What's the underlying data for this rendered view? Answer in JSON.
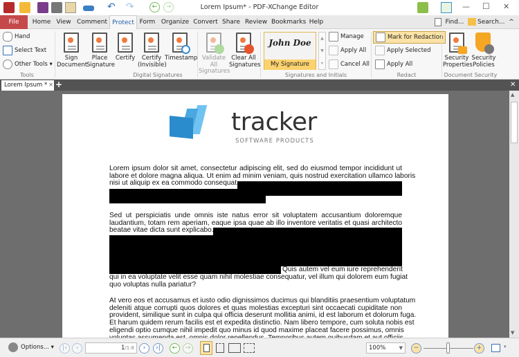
{
  "window": {
    "title": "Lorem Ipsum* - PDF-XChange Editor",
    "minimize": "—",
    "maximize": "☐",
    "close": "✕"
  },
  "menu": {
    "tabs": [
      "File",
      "Home",
      "View",
      "Comment",
      "Protect",
      "Form",
      "Organize",
      "Convert",
      "Share",
      "Review",
      "Bookmarks",
      "Help"
    ],
    "active": "Protect",
    "find": "Find...",
    "search": "Search...",
    "collapse": "^"
  },
  "ribbon": {
    "tools": {
      "label": "Tools",
      "hand": "Hand",
      "select_text": "Select Text",
      "other_tools": "Other Tools"
    },
    "digital_signatures": {
      "label": "Digital Signatures",
      "sign": "Sign Document",
      "place": "Place Signature",
      "certify": "Certify",
      "certify_invisible": "Certify (Invisible)",
      "timestamp": "Timestamp",
      "validate_all": "Validate All Signatures",
      "clear_all": "Clear All Signatures"
    },
    "signatures_initials": {
      "label": "Signatures and Initials",
      "preview_text": "John Doe",
      "selected": "My Signature",
      "manage": "Manage",
      "apply_all": "Apply All",
      "cancel_all": "Cancel All"
    },
    "redact": {
      "label": "Redact",
      "mark": "Mark for Redaction",
      "apply_selected": "Apply Selected",
      "apply_all": "Apply All"
    },
    "document_security": {
      "label": "Document Security",
      "properties": "Security Properties",
      "policies": "Security Policies"
    }
  },
  "doc_tab": {
    "label": "Lorem Ipsum *",
    "close": "×",
    "add": "+"
  },
  "logo": {
    "word": "tracker",
    "sub": "SOFTWARE PRODUCTS"
  },
  "document": {
    "lines": [
      "Lorem ipsum dolor sit amet, consectetur adipiscing elit, sed do eiusmod tempor incididunt ut",
      "labore et dolore magna aliqua. Ut enim ad minim veniam, quis nostrud exercitation ullamco laboris",
      "nisi ut aliquip ex ea commodo consequat.",
      "Sed ut perspiciatis unde omnis iste natus error sit voluptatem accusantium doloremque",
      "laudantium, totam rem aperiam, eaque ipsa quae ab illo inventore veritatis et quasi architecto",
      "beatae vitae dicta sunt explicabo.",
      "Quis autem vel eum iure reprehenderit",
      "qui in ea voluptate velit esse quam nihil molestiae consequatur, vel illum qui dolorem eum fugiat",
      "quo voluptas nulla pariatur?",
      "At vero eos et accusamus et iusto odio dignissimos ducimus qui blanditiis praesentium voluptatum",
      "deleniti atque corrupti quos dolores et quas molestias excepturi sint occaecati cupiditate non",
      "provident, similique sunt in culpa qui officia deserunt mollitia animi, id est laborum et dolorum fuga.",
      "Et harum quidem rerum facilis est et expedita distinctio. Nam libero tempore, cum soluta nobis est",
      "eligendi optio cumque nihil impedit quo minus id quod maxime placeat facere possimus, omnis",
      "voluptas assumenda est, omnis dolor repellendus. Temporibus autem quibusdam et aut officiis"
    ]
  },
  "statusbar": {
    "options": "Options...",
    "page_current": "1",
    "page_total": "/1:8",
    "zoom": "100%",
    "zoom_out": "−",
    "zoom_in": "+",
    "zoom_slider_percent": 50
  },
  "colors": {
    "file_tab": "#c5494b",
    "accent": "#1f5fa8",
    "redaction": "#000000",
    "workspace": "#6e6e6e"
  }
}
